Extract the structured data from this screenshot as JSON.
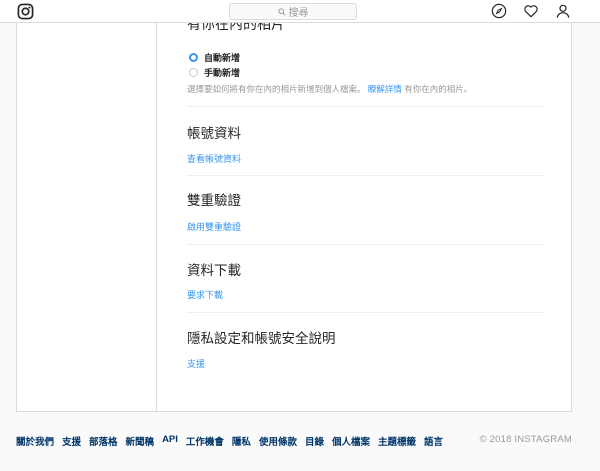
{
  "header": {
    "search_placeholder": "搜尋",
    "logo_icon": "instagram-glyph-icon",
    "nav_icons": [
      "compass-icon",
      "heart-icon",
      "person-icon"
    ]
  },
  "photos_of_you": {
    "title": "有你在內的相片",
    "options": [
      {
        "label": "自動新增",
        "selected": true
      },
      {
        "label": "手動新增",
        "selected": false
      }
    ],
    "description": "選擇要如何將有你在內的相片新增到個人檔案。",
    "learn_more": "瞭解詳情",
    "description_tail": "有你在內的相片。"
  },
  "sections": [
    {
      "title": "帳號資料",
      "link": "查看帳號資料"
    },
    {
      "title": "雙重驗證",
      "link": "啟用雙重驗證"
    },
    {
      "title": "資料下載",
      "link": "要求下載"
    },
    {
      "title": "隱私設定和帳號安全說明",
      "link": "支援"
    }
  ],
  "footer": {
    "links": [
      "關於我們",
      "支援",
      "部落格",
      "新聞稿",
      "API",
      "工作機會",
      "隱私",
      "使用條款",
      "目錄",
      "個人檔案",
      "主題標籤",
      "語言"
    ],
    "copyright": "© 2018 INSTAGRAM"
  },
  "colors": {
    "accent": "#3897f0",
    "footer_link": "#003569",
    "muted": "#999999",
    "border": "#dbdbdb"
  }
}
